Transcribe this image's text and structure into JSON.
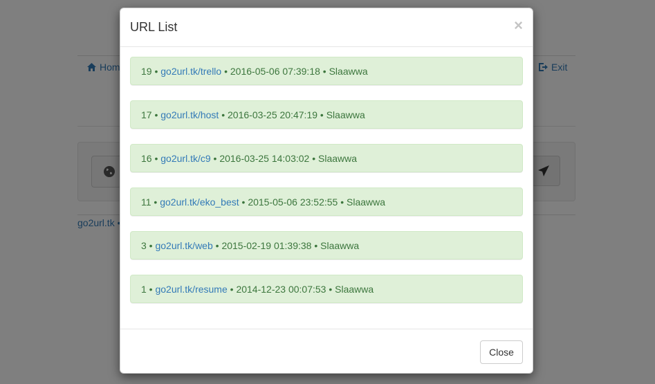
{
  "background": {
    "nav": {
      "home_label": "Home",
      "exit_label": "Exit"
    },
    "footer_text": "go2url.tk •"
  },
  "modal": {
    "title": "URL List",
    "close_symbol": "×",
    "rows": [
      {
        "id": "19",
        "link": "go2url.tk/trello",
        "date": "2016-05-06 07:39:18",
        "user": "Slaawwa"
      },
      {
        "id": "17",
        "link": "go2url.tk/host",
        "date": "2016-03-25 20:47:19",
        "user": "Slaawwa"
      },
      {
        "id": "16",
        "link": "go2url.tk/c9",
        "date": "2016-03-25 14:03:02",
        "user": "Slaawwa"
      },
      {
        "id": "11",
        "link": "go2url.tk/eko_best",
        "date": "2015-05-06 23:52:55",
        "user": "Slaawwa"
      },
      {
        "id": "3",
        "link": "go2url.tk/web",
        "date": "2015-02-19 01:39:38",
        "user": "Slaawwa"
      },
      {
        "id": "1",
        "link": "go2url.tk/resume",
        "date": "2014-12-23 00:07:53",
        "user": "Slaawwa"
      }
    ],
    "close_button_label": "Close"
  },
  "separator": " • ",
  "icons": {
    "home": "home-icon",
    "exit": "exit-icon",
    "globe": "globe-icon",
    "send": "send-icon"
  },
  "colors": {
    "row_bg": "#dff0d8",
    "row_text": "#3c763d",
    "link": "#337ab7"
  }
}
